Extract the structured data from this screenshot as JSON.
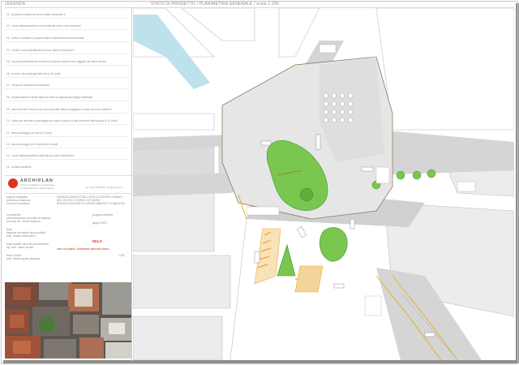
{
  "header": {
    "left_label": "LEGENDA",
    "center_label": "STATO DI PROGETTO / PLANIMETRIA GENERALE / scala 1:200"
  },
  "legend": {
    "items": [
      "01 - accordo completo da corso vittorio emanuele II",
      "02 - nuovo attraversamento ciclo-pedonale verso corso umberto I",
      "03 - sedute a mattone in piazza caduti e alberatura storica vincolata",
      "04 - cordoli e area alla alberatura verso vittorio emanuele II",
      "05 - nuova pavimentazione su lato est di piazza caduti come suggello del centro storico",
      "06 - numero dei parcheggi delle fila (n.36 posti)",
      "07 - rampa per accesso al sottopasso",
      "08 - riposizionamento della statua di Garin su grande parcheggio antistante",
      "09 - area riservata e diversa da zona pedonale della carreggiata in uscita da corso umberto I",
      "10 - sosta con riservata a parcheggio per carico-scarico su altri sottovoci della piazza (n.10 posti)",
      "11 - area parcheggio per taxi (n.5 posti)",
      "12 - area parcheggio per motocicli (n.6 posti)",
      "13 - nuovo attraversamento pedonale su corso della libertà",
      "14 - fontana esistente"
    ]
  },
  "title_block": {
    "firm_name": "ARCHIPLAN",
    "firm_sub": "studio di architettura e pianificazione",
    "firm_sub2": "via della libertà 22 - 46100 mantova",
    "firm_contact": "tel +39 0376 000000 - info@archiplan.it",
    "region": "regione lombardia",
    "province": "provincia di mantova",
    "municipality": "comune di mantova",
    "project_title": [
      "RIMODELLAMENTO DELL'ASSE DI CENTRO URBANO",
      "DEL CENTRO STORICO CITTADINO",
      "RIQUALIFICAZIONE DI CORSO UMBERTO I E MARCONI"
    ],
    "client_label": "committente",
    "client_lines": [
      "amministrazione comunale di mantova",
      "via roma 39 - 46100 mantova"
    ],
    "team_label": "team",
    "team_lines": [
      "dirigente del settore lavori pubblici",
      "arch. cosimo mastroianni"
    ],
    "responsible_label": "responsabile unico del procedimento",
    "responsible_lines": [
      "ing. arch. mauro ferretti"
    ],
    "design_label": "firme e timbri",
    "design_lines": [
      "arch. stefano guido campana"
    ],
    "phase": "progetto definitivo",
    "date": "giugno 2019",
    "sheet_code": "D01.0",
    "sheet_desc": "stato di progetto / planimetria generale piazza",
    "scale": "1:200"
  },
  "plan": {
    "colors": {
      "road": "#d2d2d2",
      "plaza": "#e6e6e6",
      "green": "#7ac74f",
      "green_dark": "#3f8f2f",
      "water": "#bde2ee",
      "building": "#e9e9e9",
      "yellow": "#e2b41e",
      "orange": "#f0a23a",
      "curb": "#8a7d5a"
    }
  }
}
